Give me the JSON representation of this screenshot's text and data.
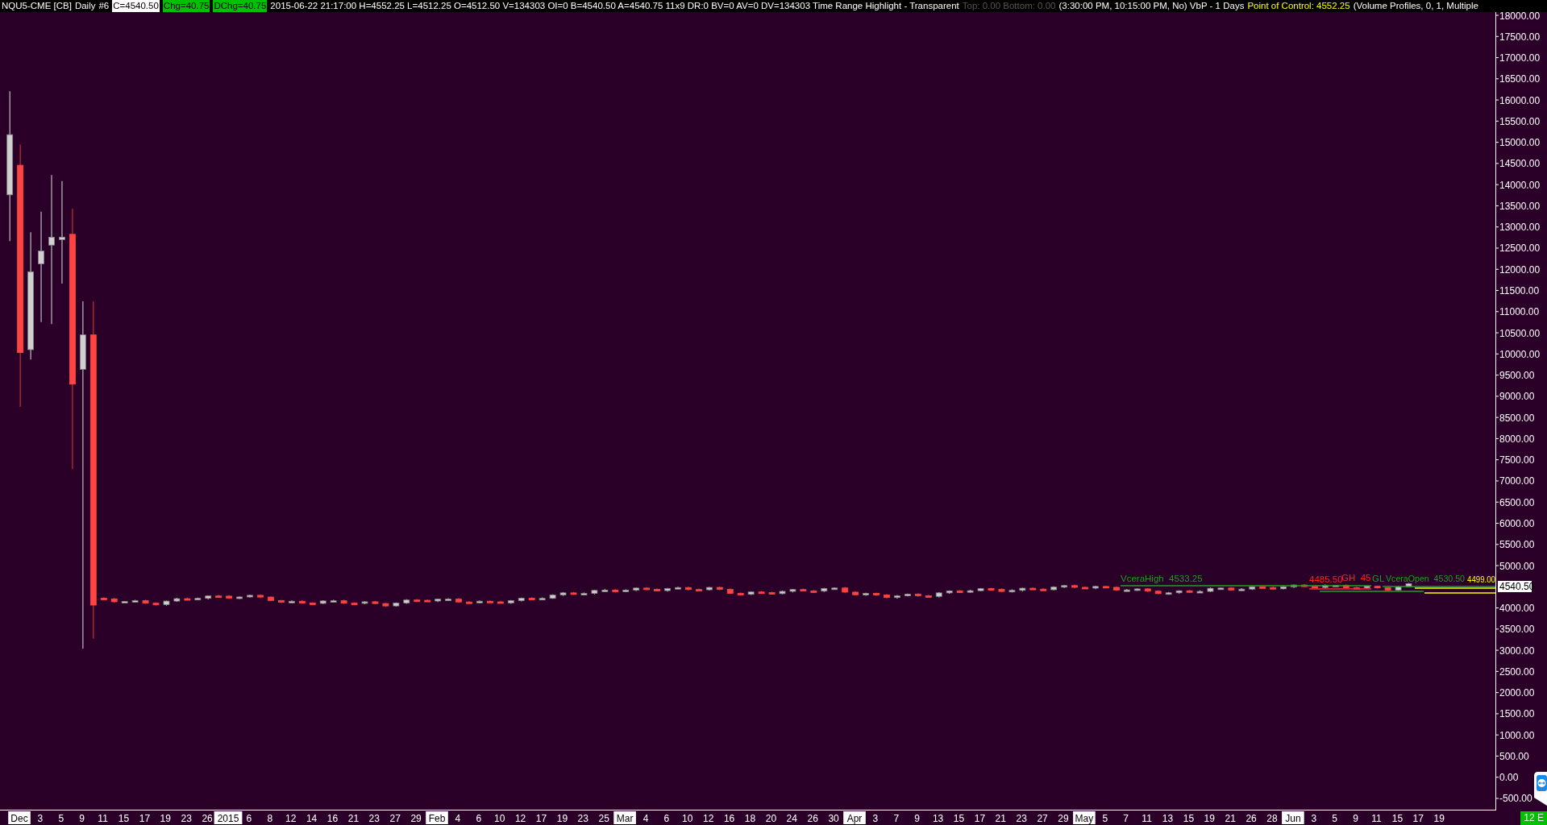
{
  "header": {
    "symbol": "NQU5-CME [CB]",
    "interval": "Daily",
    "chart_number": "#6",
    "close": "C=4540.50",
    "change": "Chg=40.75",
    "daily_change": "DChg=40.75",
    "details": "2015-06-22 21:17:00 H=4552.25 L=4512.25 O=4512.50 V=134303 OI=0 B=4540.50 A=4540.75 11x9 DR:0 BV=0 AV=0 DV=134303 Time Range Highlight - Transparent",
    "dimmed": "Top: 0.00  Bottom: 0.00",
    "session": "(3:30:00 PM, 10:15:00 PM, No)  VbP - 1 Days",
    "point_of_control": "Point of Control: 4552.25",
    "study": "(Volume Profiles, 0, 1, Multiple"
  },
  "price_axis": {
    "labels": [
      "18000.00",
      "17500.00",
      "17000.00",
      "16500.00",
      "16000.00",
      "15500.00",
      "15000.00",
      "14500.00",
      "14000.00",
      "13500.00",
      "13000.00",
      "12500.00",
      "12000.00",
      "11500.00",
      "11000.00",
      "10500.00",
      "10000.00",
      "9500.00",
      "9000.00",
      "8500.00",
      "8000.00",
      "7500.00",
      "7000.00",
      "6500.00",
      "6000.00",
      "5500.00",
      "5000.00",
      "4000.00",
      "3500.00",
      "3000.00",
      "2500.00",
      "2000.00",
      "1500.00",
      "1000.00",
      "500.00",
      "0.00",
      "-500.00"
    ],
    "last_price": "4540.50"
  },
  "date_axis": {
    "labels": [
      {
        "text": "Dec",
        "kind": "month"
      },
      {
        "text": "3",
        "kind": "day"
      },
      {
        "text": "5",
        "kind": "day"
      },
      {
        "text": "9",
        "kind": "day"
      },
      {
        "text": "11",
        "kind": "day"
      },
      {
        "text": "15",
        "kind": "day"
      },
      {
        "text": "17",
        "kind": "day"
      },
      {
        "text": "19",
        "kind": "day"
      },
      {
        "text": "23",
        "kind": "day"
      },
      {
        "text": "26",
        "kind": "day"
      },
      {
        "text": "2015",
        "kind": "month"
      },
      {
        "text": "6",
        "kind": "day"
      },
      {
        "text": "8",
        "kind": "day"
      },
      {
        "text": "12",
        "kind": "day"
      },
      {
        "text": "14",
        "kind": "day"
      },
      {
        "text": "16",
        "kind": "day"
      },
      {
        "text": "21",
        "kind": "day"
      },
      {
        "text": "23",
        "kind": "day"
      },
      {
        "text": "27",
        "kind": "day"
      },
      {
        "text": "29",
        "kind": "day"
      },
      {
        "text": "Feb",
        "kind": "month"
      },
      {
        "text": "4",
        "kind": "day"
      },
      {
        "text": "6",
        "kind": "day"
      },
      {
        "text": "10",
        "kind": "day"
      },
      {
        "text": "12",
        "kind": "day"
      },
      {
        "text": "17",
        "kind": "day"
      },
      {
        "text": "19",
        "kind": "day"
      },
      {
        "text": "23",
        "kind": "day"
      },
      {
        "text": "25",
        "kind": "day"
      },
      {
        "text": "Mar",
        "kind": "month"
      },
      {
        "text": "4",
        "kind": "day"
      },
      {
        "text": "6",
        "kind": "day"
      },
      {
        "text": "10",
        "kind": "day"
      },
      {
        "text": "12",
        "kind": "day"
      },
      {
        "text": "16",
        "kind": "day"
      },
      {
        "text": "18",
        "kind": "day"
      },
      {
        "text": "20",
        "kind": "day"
      },
      {
        "text": "24",
        "kind": "day"
      },
      {
        "text": "26",
        "kind": "day"
      },
      {
        "text": "30",
        "kind": "day"
      },
      {
        "text": "Apr",
        "kind": "month"
      },
      {
        "text": "3",
        "kind": "day"
      },
      {
        "text": "7",
        "kind": "day"
      },
      {
        "text": "9",
        "kind": "day"
      },
      {
        "text": "13",
        "kind": "day"
      },
      {
        "text": "15",
        "kind": "day"
      },
      {
        "text": "17",
        "kind": "day"
      },
      {
        "text": "21",
        "kind": "day"
      },
      {
        "text": "23",
        "kind": "day"
      },
      {
        "text": "27",
        "kind": "day"
      },
      {
        "text": "29",
        "kind": "day"
      },
      {
        "text": "May",
        "kind": "month"
      },
      {
        "text": "5",
        "kind": "day"
      },
      {
        "text": "7",
        "kind": "day"
      },
      {
        "text": "11",
        "kind": "day"
      },
      {
        "text": "13",
        "kind": "day"
      },
      {
        "text": "15",
        "kind": "day"
      },
      {
        "text": "19",
        "kind": "day"
      },
      {
        "text": "21",
        "kind": "day"
      },
      {
        "text": "26",
        "kind": "day"
      },
      {
        "text": "28",
        "kind": "day"
      },
      {
        "text": "Jun",
        "kind": "month"
      },
      {
        "text": "3",
        "kind": "day"
      },
      {
        "text": "5",
        "kind": "day"
      },
      {
        "text": "9",
        "kind": "day"
      },
      {
        "text": "11",
        "kind": "day"
      },
      {
        "text": "15",
        "kind": "day"
      },
      {
        "text": "17",
        "kind": "day"
      },
      {
        "text": "19",
        "kind": "day"
      }
    ]
  },
  "chart_labels": [
    {
      "text": "VceraHigh  4533.25",
      "color": "#1ea01e"
    },
    {
      "text": "4485.50",
      "color": "#ff2020"
    },
    {
      "text": "GH  45",
      "color": "#ff2020"
    },
    {
      "text": "GL",
      "color": "#1ea01e"
    },
    {
      "text": "VceraOpen  4530.50",
      "color": "#1ea01e"
    },
    {
      "text": "4499.00",
      "color": "#ffff00"
    }
  ],
  "status": "12 E"
}
